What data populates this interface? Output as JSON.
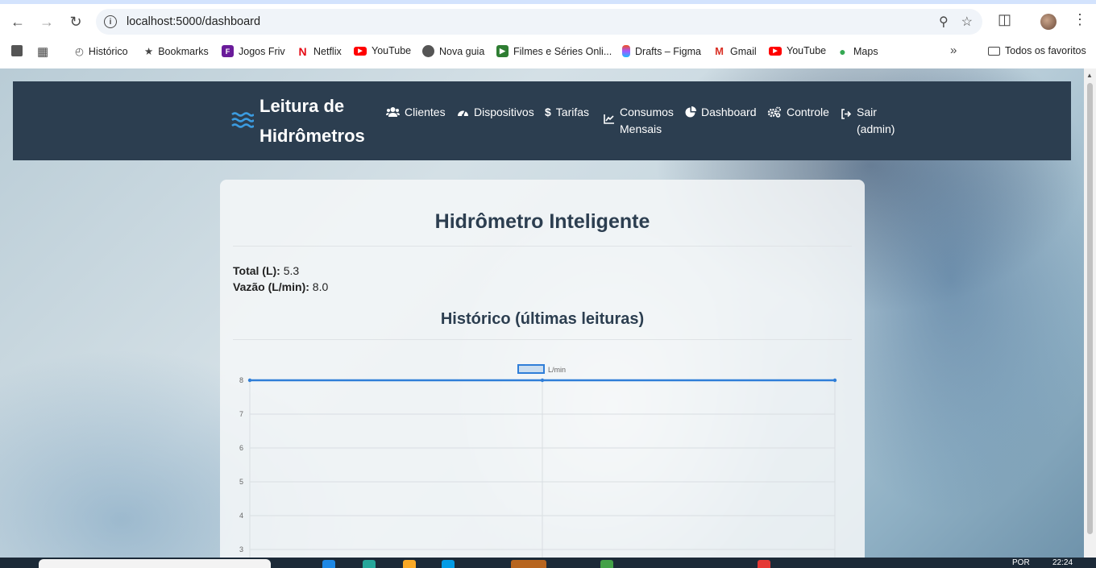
{
  "browser": {
    "url": "localhost:5000/dashboard",
    "bookmarks": [
      {
        "label": "Histórico",
        "icon": "history-icon"
      },
      {
        "label": "Bookmarks",
        "icon": "star-icon"
      },
      {
        "label": "Jogos Friv",
        "icon": "friv-icon"
      },
      {
        "label": "Netflix",
        "icon": "netflix-icon"
      },
      {
        "label": "YouTube",
        "icon": "youtube-icon"
      },
      {
        "label": "Nova guia",
        "icon": "globe-icon"
      },
      {
        "label": "Filmes e Séries Onli...",
        "icon": "film-icon"
      },
      {
        "label": "Drafts – Figma",
        "icon": "figma-icon"
      },
      {
        "label": "Gmail",
        "icon": "gmail-icon"
      },
      {
        "label": "YouTube",
        "icon": "youtube-icon"
      },
      {
        "label": "Maps",
        "icon": "maps-icon"
      }
    ],
    "all_bookmarks": "Todos os favoritos"
  },
  "navbar": {
    "brand": "Leitura de Hidrômetros",
    "items": [
      {
        "label": "Clientes",
        "icon": "users-icon"
      },
      {
        "label": "Dispositivos",
        "icon": "gauge-icon"
      },
      {
        "label": "Tarifas",
        "icon": "dollar-icon"
      },
      {
        "label": "Consumos Mensais",
        "icon": "chart-line-icon"
      },
      {
        "label": "Dashboard",
        "icon": "pie-chart-icon"
      },
      {
        "label": "Controle",
        "icon": "gears-icon"
      },
      {
        "label": "Sair (admin)",
        "icon": "sign-out-icon"
      }
    ]
  },
  "card": {
    "title": "Hidrômetro Inteligente",
    "total_label": "Total (L):",
    "total_value": "5.3",
    "flow_label": "Vazão (L/min):",
    "flow_value": "8.0",
    "history_title": "Histórico (últimas leituras)"
  },
  "chart_data": {
    "type": "line",
    "series": [
      {
        "name": "L/min",
        "values": [
          8,
          8,
          8
        ]
      }
    ],
    "categories": [
      "",
      "",
      ""
    ],
    "y_ticks_visible": [
      8,
      7,
      6,
      5,
      4,
      3
    ],
    "legend": "top-center",
    "grid": true,
    "color": "#2f7ed8"
  },
  "taskbar": {
    "lang": "POR",
    "time": "22:24"
  }
}
